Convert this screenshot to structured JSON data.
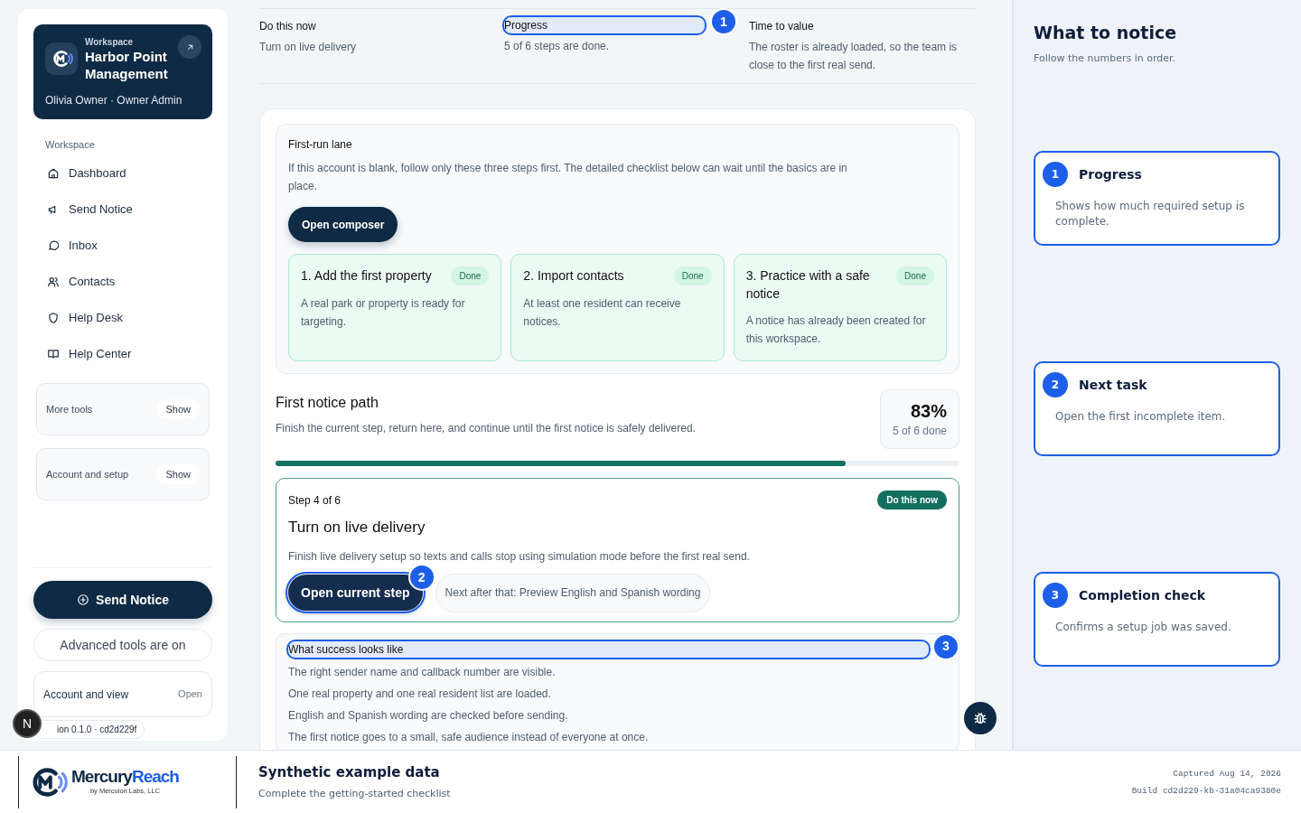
{
  "sidebar": {
    "workspace_card": {
      "label": "Workspace",
      "name": "Harbor Point Management",
      "user": "Olivia Owner · Owner Admin"
    },
    "section_label": "Workspace",
    "nav_items": [
      {
        "label": "Dashboard"
      },
      {
        "label": "Send Notice"
      },
      {
        "label": "Inbox"
      },
      {
        "label": "Contacts"
      },
      {
        "label": "Help Desk"
      },
      {
        "label": "Help Center"
      }
    ],
    "collapsibles": [
      {
        "label": "More tools",
        "action": "Show"
      },
      {
        "label": "Account and setup",
        "action": "Show"
      }
    ],
    "send_button": "Send Notice",
    "advanced": "Advanced tools are on",
    "account": {
      "label": "Account and view",
      "action": "Open"
    },
    "version": "ion 0.1.0 · cd2d229f",
    "avatar": "N"
  },
  "summary": [
    {
      "title": "Do this now",
      "text": "Turn on live delivery"
    },
    {
      "title": "Progress",
      "text": "5 of 6 steps are done.",
      "marker": "1"
    },
    {
      "title": "Time to value",
      "text": "The roster is already loaded, so the team is close to the first real send."
    }
  ],
  "first_run": {
    "title": "First-run lane",
    "text": "If this account is blank, follow only these three steps first. The detailed checklist below can wait until the basics are in place.",
    "button": "Open composer",
    "steps": [
      {
        "title": "1. Add the first property",
        "badge": "Done",
        "text": "A real park or property is ready for targeting."
      },
      {
        "title": "2. Import contacts",
        "badge": "Done",
        "text": "At least one resident can receive notices."
      },
      {
        "title": "3. Practice with a safe notice",
        "badge": "Done",
        "text": "A notice has already been created for this workspace."
      }
    ]
  },
  "path": {
    "title": "First notice path",
    "text": "Finish the current step, return here, and continue until the first notice is safely delivered.",
    "percent": "83%",
    "count": "5 of 6 done",
    "level": 0.833
  },
  "current_step": {
    "step": "Step 4 of 6",
    "badge": "Do this now",
    "title": "Turn on live delivery",
    "text": "Finish live delivery setup so texts and calls stop using simulation mode before the first real send.",
    "button": "Open current step",
    "button_marker": "2",
    "next": "Next after that: Preview English and Spanish wording"
  },
  "success": {
    "title": "What success looks like",
    "marker": "3",
    "items": [
      "The right sender name and callback number are visible.",
      "One real property and one real resident list are loaded.",
      "English and Spanish wording are checked before sending.",
      "The first notice goes to a small, safe audience instead of everyone at once."
    ]
  },
  "guide": {
    "title": "What to notice",
    "subtitle": "Follow the numbers in order.",
    "notes": [
      {
        "number": "1",
        "title": "Progress",
        "text": "Shows how much required setup is complete."
      },
      {
        "number": "2",
        "title": "Next task",
        "text": "Open the first incomplete item."
      },
      {
        "number": "3",
        "title": "Completion check",
        "text": "Confirms a setup job was saved."
      }
    ]
  },
  "footer": {
    "brand_dark": "Mercury",
    "brand_accent": "Reach",
    "brand_tagline": "by Mercuion Labs, LLC",
    "title": "Synthetic example data",
    "subtitle": "Complete the getting-started checklist",
    "captured": "Captured Aug 14, 2026",
    "build": "Build cd2d229-kb-31a04ca9380e"
  }
}
